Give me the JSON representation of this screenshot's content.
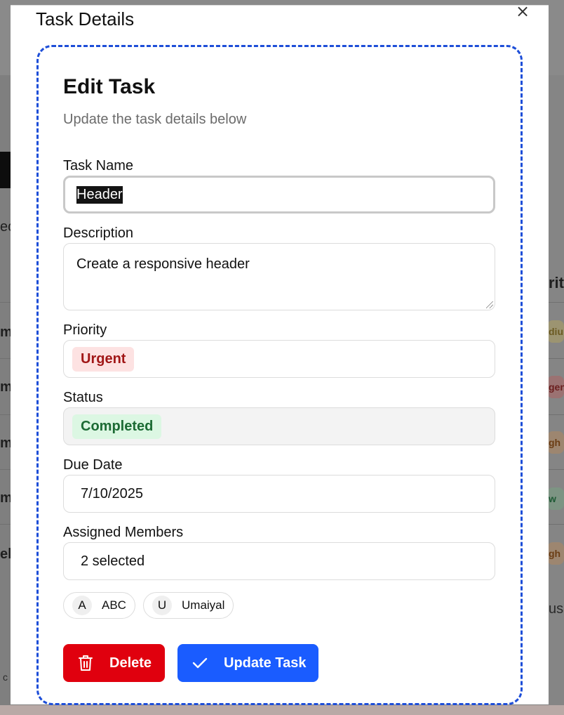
{
  "background": {
    "left_fragments": [
      "ec",
      "m",
      "m",
      "m",
      "m",
      "el"
    ],
    "right_header": "rity",
    "right_pills": [
      {
        "text": "diu",
        "color": "#b9a66b"
      },
      {
        "text": "gen",
        "color": "#b66b6b"
      },
      {
        "text": "gh",
        "color": "#b98c62"
      },
      {
        "text": "w",
        "color": "#7ea98c"
      },
      {
        "text": "gh",
        "color": "#b98c62"
      }
    ],
    "right_text": "us.",
    "footer_text": "c"
  },
  "modal": {
    "title": "Task Details",
    "close_glyph": "×",
    "heading": "Edit Task",
    "subtitle": "Update the task details below"
  },
  "form": {
    "task_name": {
      "label": "Task Name",
      "value": "Header"
    },
    "description": {
      "label": "Description",
      "value": "Create a responsive header"
    },
    "priority": {
      "label": "Priority",
      "value": "Urgent",
      "color": "#a11717"
    },
    "status": {
      "label": "Status",
      "value": "Completed",
      "color": "#1c6b34"
    },
    "due_date": {
      "label": "Due Date",
      "value": "7/10/2025"
    },
    "assigned_members": {
      "label": "Assigned Members",
      "value": "2 selected",
      "members": [
        {
          "initial": "A",
          "name": "ABC"
        },
        {
          "initial": "U",
          "name": "Umaiyal"
        }
      ]
    }
  },
  "actions": {
    "delete_label": "Delete",
    "delete_icon": "trash-icon",
    "update_label": "Update Task",
    "update_icon": "check-icon",
    "delete_color": "#e0000e",
    "update_color": "#1a5cff"
  }
}
